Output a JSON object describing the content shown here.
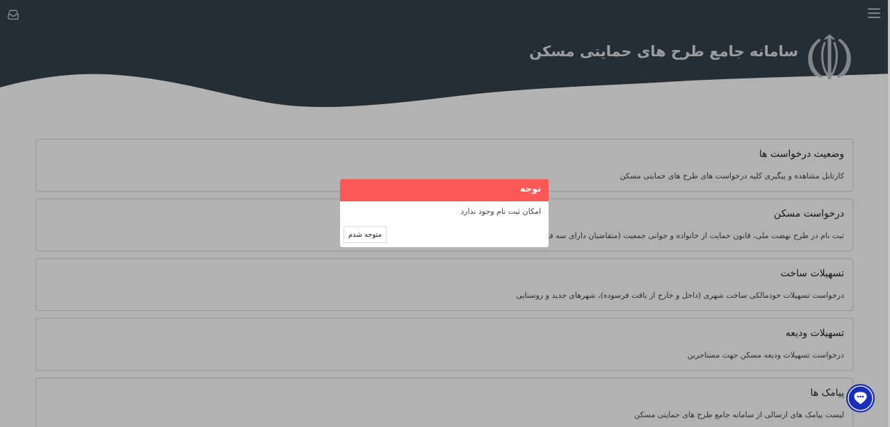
{
  "header": {
    "title": "سامانه جامع طرح های حمایتی مسکن",
    "icons": {
      "menu": "hamburger-menu-icon",
      "inbox": "inbox-icon",
      "emblem": "iran-emblem-logo"
    },
    "colors": {
      "background": "#37434d",
      "title": "#dfe3e6"
    }
  },
  "cards": [
    {
      "title": "وضعیت درخواست ها",
      "description": "کارتابل مشاهده و پیگیری کلیه درخواست های طرح های حمایتی مسکن"
    },
    {
      "title": "درخواست مسکن",
      "description": "ثبت نام در طرح نهضت ملی، قانون حمایت از خانواده و جوانی جمعیت (متقاضیان دارای سه فرزند یا بیشتر)"
    },
    {
      "title": "تسهیلات ساخت",
      "description": "درخواست تسهیلات خودمالکی ساخت شهری (داخل و خارج از بافت فرسوده)، شهرهای جدید و روستایی"
    },
    {
      "title": "تسهیلات ودیعه",
      "description": "درخواست تسهیلات ودیعه مسکن جهت مستاجرین"
    },
    {
      "title": "پیامک ها",
      "description": "لیست پیامک های ارسالی از سامانه جامع طرح های حمایتی مسکن"
    }
  ],
  "modal": {
    "title": "توجه",
    "message": "امکان ثبت نام وجود ندارد",
    "button_label": "متوجه شدم",
    "header_color": "#fe5757"
  },
  "chat": {
    "icon": "chat-support-icon",
    "color": "#1a2fb8"
  }
}
